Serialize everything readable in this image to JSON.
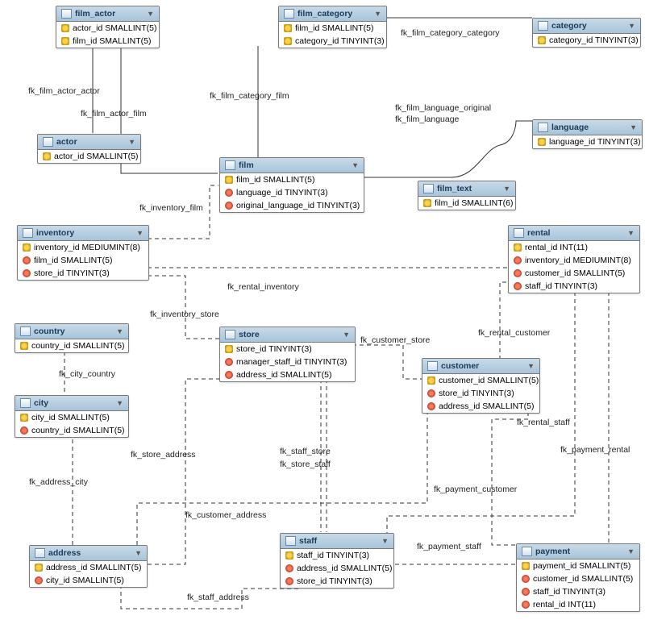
{
  "tables": {
    "film_actor": {
      "name": "film_actor",
      "cols": [
        {
          "t": "pk",
          "s": "actor_id SMALLINT(5)"
        },
        {
          "t": "pk",
          "s": "film_id SMALLINT(5)"
        }
      ]
    },
    "film_category": {
      "name": "film_category",
      "cols": [
        {
          "t": "pk",
          "s": "film_id SMALLINT(5)"
        },
        {
          "t": "pk",
          "s": "category_id TINYINT(3)"
        }
      ]
    },
    "category": {
      "name": "category",
      "cols": [
        {
          "t": "pk",
          "s": "category_id TINYINT(3)"
        }
      ]
    },
    "actor": {
      "name": "actor",
      "cols": [
        {
          "t": "pk",
          "s": "actor_id SMALLINT(5)"
        }
      ]
    },
    "language": {
      "name": "language",
      "cols": [
        {
          "t": "pk",
          "s": "language_id TINYINT(3)"
        }
      ]
    },
    "film": {
      "name": "film",
      "cols": [
        {
          "t": "pk",
          "s": "film_id SMALLINT(5)"
        },
        {
          "t": "fk",
          "s": "language_id TINYINT(3)"
        },
        {
          "t": "fk",
          "s": "original_language_id TINYINT(3)"
        }
      ]
    },
    "film_text": {
      "name": "film_text",
      "cols": [
        {
          "t": "pk",
          "s": "film_id SMALLINT(6)"
        }
      ]
    },
    "inventory": {
      "name": "inventory",
      "cols": [
        {
          "t": "pk",
          "s": "inventory_id MEDIUMINT(8)"
        },
        {
          "t": "fk",
          "s": "film_id SMALLINT(5)"
        },
        {
          "t": "fk",
          "s": "store_id TINYINT(3)"
        }
      ]
    },
    "rental": {
      "name": "rental",
      "cols": [
        {
          "t": "pk",
          "s": "rental_id INT(11)"
        },
        {
          "t": "fk",
          "s": "inventory_id MEDIUMINT(8)"
        },
        {
          "t": "fk",
          "s": "customer_id SMALLINT(5)"
        },
        {
          "t": "fk",
          "s": "staff_id TINYINT(3)"
        }
      ]
    },
    "country": {
      "name": "country",
      "cols": [
        {
          "t": "pk",
          "s": "country_id SMALLINT(5)"
        }
      ]
    },
    "store": {
      "name": "store",
      "cols": [
        {
          "t": "pk",
          "s": "store_id TINYINT(3)"
        },
        {
          "t": "fk",
          "s": "manager_staff_id TINYINT(3)"
        },
        {
          "t": "fk",
          "s": "address_id SMALLINT(5)"
        }
      ]
    },
    "customer": {
      "name": "customer",
      "cols": [
        {
          "t": "pk",
          "s": "customer_id SMALLINT(5)"
        },
        {
          "t": "fk",
          "s": "store_id TINYINT(3)"
        },
        {
          "t": "fk",
          "s": "address_id SMALLINT(5)"
        }
      ]
    },
    "city": {
      "name": "city",
      "cols": [
        {
          "t": "pk",
          "s": "city_id SMALLINT(5)"
        },
        {
          "t": "fk",
          "s": "country_id SMALLINT(5)"
        }
      ]
    },
    "address": {
      "name": "address",
      "cols": [
        {
          "t": "pk",
          "s": "address_id SMALLINT(5)"
        },
        {
          "t": "fk",
          "s": "city_id SMALLINT(5)"
        }
      ]
    },
    "staff": {
      "name": "staff",
      "cols": [
        {
          "t": "pk",
          "s": "staff_id TINYINT(3)"
        },
        {
          "t": "fk",
          "s": "address_id SMALLINT(5)"
        },
        {
          "t": "fk",
          "s": "store_id TINYINT(3)"
        }
      ]
    },
    "payment": {
      "name": "payment",
      "cols": [
        {
          "t": "pk",
          "s": "payment_id SMALLINT(5)"
        },
        {
          "t": "fk",
          "s": "customer_id SMALLINT(5)"
        },
        {
          "t": "fk",
          "s": "staff_id TINYINT(3)"
        },
        {
          "t": "fk",
          "s": "rental_id INT(11)"
        }
      ]
    }
  },
  "fks": {
    "fk_film_actor_actor": "fk_film_actor_actor",
    "fk_film_actor_film": "fk_film_actor_film",
    "fk_film_category_category": "fk_film_category_category",
    "fk_film_category_film": "fk_film_category_film",
    "fk_film_language_original": "fk_film_language_original",
    "fk_film_language": "fk_film_language",
    "fk_inventory_film": "fk_inventory_film",
    "fk_rental_inventory": "fk_rental_inventory",
    "fk_inventory_store": "fk_inventory_store",
    "fk_city_country": "fk_city_country",
    "fk_customer_store": "fk_customer_store",
    "fk_rental_customer": "fk_rental_customer",
    "fk_rental_staff": "fk_rental_staff",
    "fk_payment_rental": "fk_payment_rental",
    "fk_store_address": "fk_store_address",
    "fk_staff_store": "fk_staff_store",
    "fk_store_staff": "fk_store_staff",
    "fk_payment_customer": "fk_payment_customer",
    "fk_address_city": "fk_address_city",
    "fk_customer_address": "fk_customer_address",
    "fk_payment_staff": "fk_payment_staff",
    "fk_staff_address": "fk_staff_address"
  }
}
